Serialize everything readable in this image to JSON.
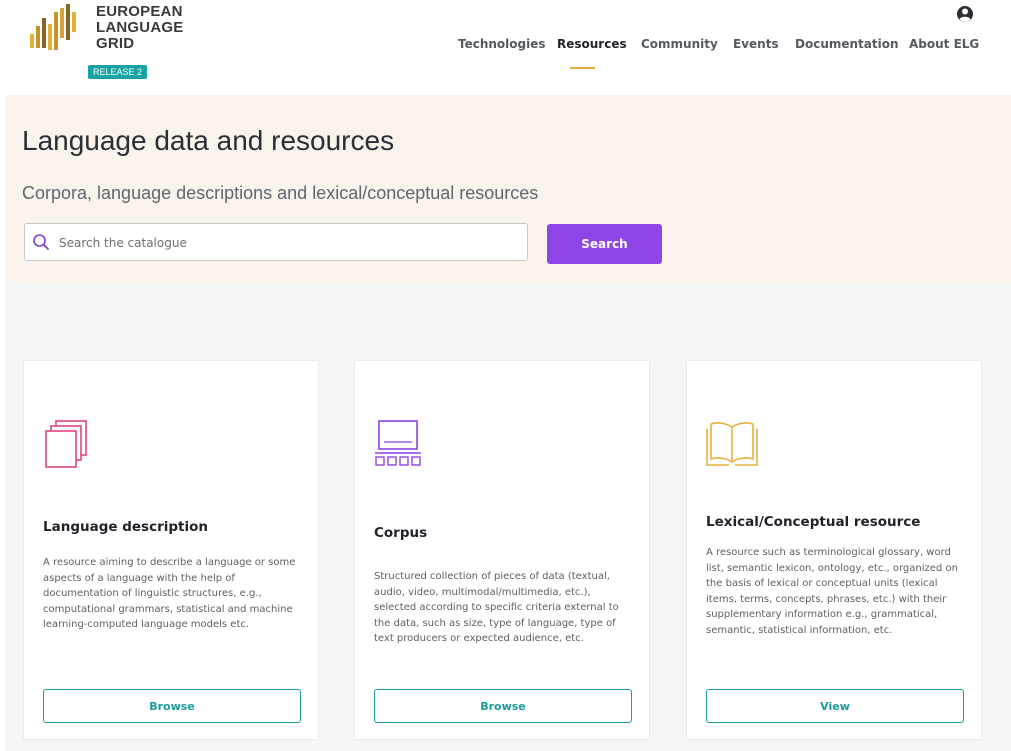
{
  "brand": {
    "lines": [
      "EUROPEAN",
      "LANGUAGE",
      "GRID"
    ],
    "release": "RELEASE 2",
    "colors": [
      "#e3b136",
      "#c8922a",
      "#8c6326",
      "#d4a33a"
    ]
  },
  "nav": {
    "items": [
      {
        "label": "Technologies"
      },
      {
        "label": "Resources",
        "active": true
      },
      {
        "label": "Community"
      },
      {
        "label": "Events"
      },
      {
        "label": "Documentation"
      },
      {
        "label": "About ELG"
      }
    ],
    "user_icon": "user-circle-icon",
    "accent": "#e8b13d"
  },
  "hero": {
    "title": "Language data and resources",
    "subtitle": "Corpora, language descriptions and lexical/conceptual resources",
    "search_placeholder": "Search the catalogue",
    "search_icon": "search-icon",
    "search_button": "Search",
    "button_color": "#8e44e6"
  },
  "cards": [
    {
      "title": "Language description",
      "description": "A resource aiming to describe a language or some aspects of a language with the help of documentation of linguistic structures, e.g., computational grammars, statistical and machine learning-computed language models etc.",
      "button": "Browse",
      "icon": "stacked-documents-icon",
      "icon_color": "#e0457b"
    },
    {
      "title": "Corpus",
      "description": "Structured collection of pieces of data (textual, audio, video, multimodal/multimedia, etc.), selected according to specific criteria external to the data, such as size, type of language, type of text producers or expected audience, etc.",
      "button": "Browse",
      "icon": "presentation-screen-icon",
      "icon_color": "#8e44e6"
    },
    {
      "title": "Lexical/Conceptual resource",
      "description": "A resource such as terminological glossary, word list, semantic lexicon, ontology, etc., organized on the basis of lexical or conceptual units (lexical items, terms, concepts, phrases, etc.) with their supplementary information e.g., grammatical, semantic, statistical information, etc.",
      "button": "View",
      "icon": "open-book-icon",
      "icon_color": "#e8b13d"
    }
  ]
}
